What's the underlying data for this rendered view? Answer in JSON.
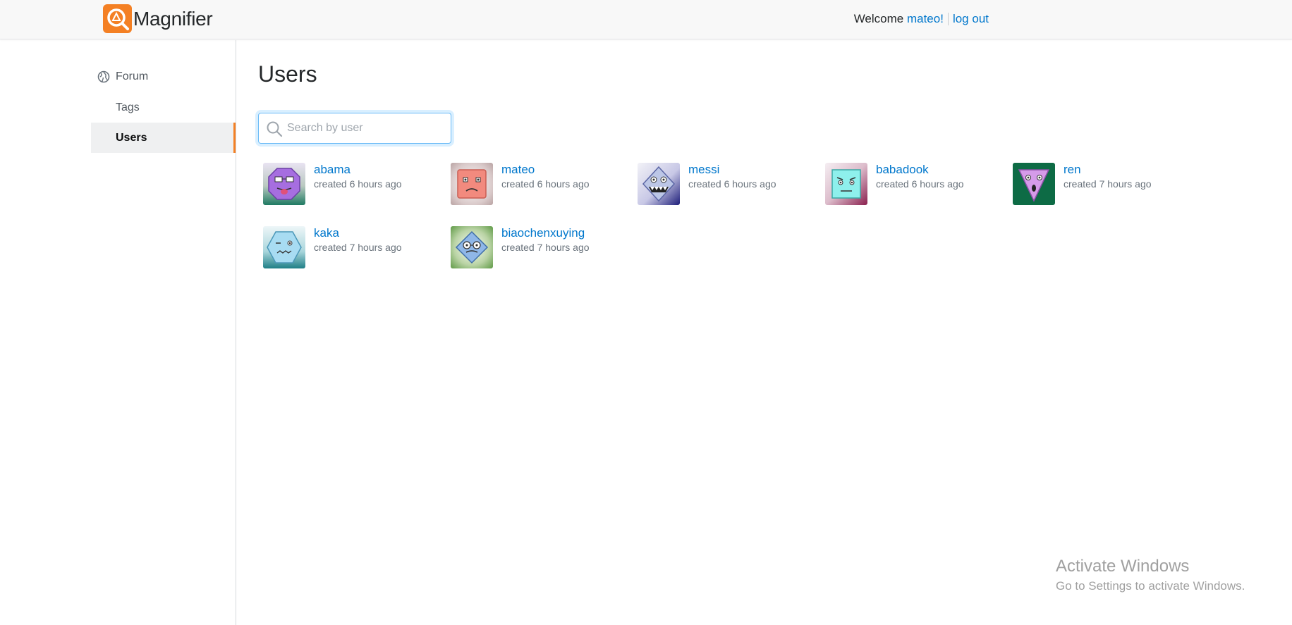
{
  "header": {
    "app_name": "Magnifier",
    "welcome_text": "Welcome",
    "username_link": "mateo!",
    "logout_label": "log out",
    "accent_color": "#f48024"
  },
  "sidebar": {
    "items": [
      {
        "label": "Forum",
        "icon": "globe-icon",
        "active": false
      },
      {
        "label": "Tags",
        "active": false
      },
      {
        "label": "Users",
        "active": true
      }
    ]
  },
  "main": {
    "title": "Users",
    "search": {
      "placeholder": "Search by user",
      "value": ""
    },
    "users": [
      {
        "name": "abama",
        "created": "created 6 hours ago"
      },
      {
        "name": "mateo",
        "created": "created 6 hours ago"
      },
      {
        "name": "messi",
        "created": "created 6 hours ago"
      },
      {
        "name": "babadook",
        "created": "created 6 hours ago"
      },
      {
        "name": "ren",
        "created": "created 7 hours ago"
      },
      {
        "name": "kaka",
        "created": "created 7 hours ago"
      },
      {
        "name": "biaochenxuying",
        "created": "created 7 hours ago"
      }
    ]
  },
  "watermark": {
    "line1": "Activate Windows",
    "line2": "Go to Settings to activate Windows."
  }
}
